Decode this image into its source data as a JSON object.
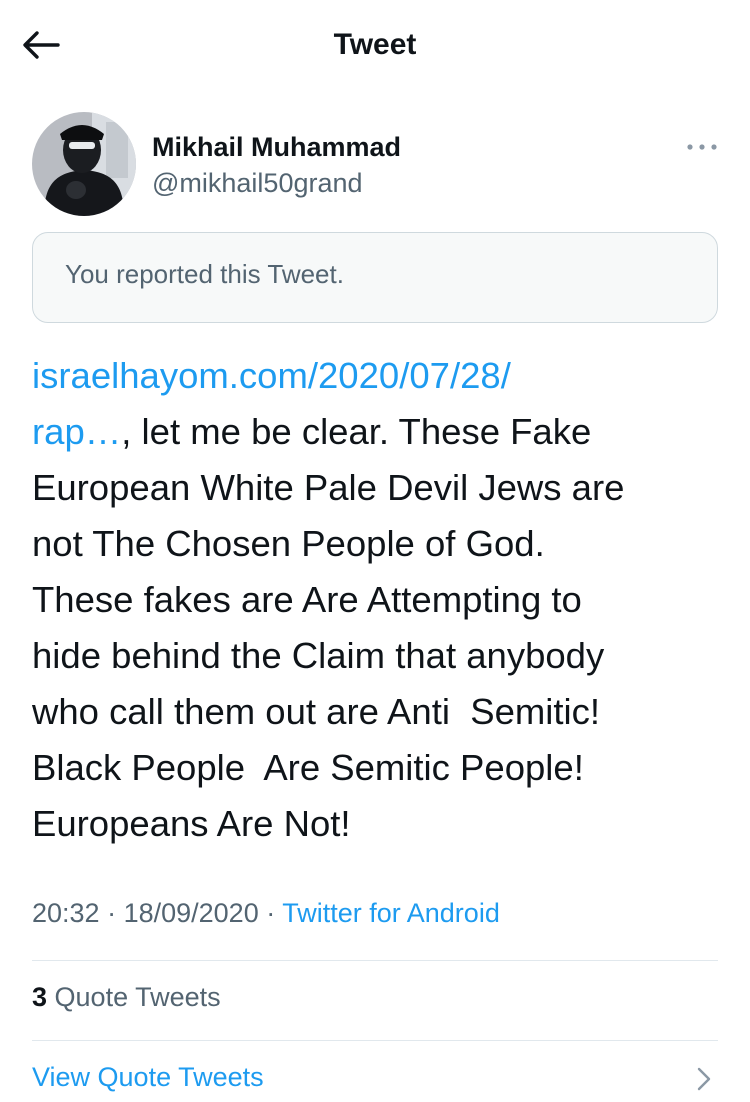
{
  "header": {
    "title": "Tweet",
    "back_icon": "arrow-left-icon"
  },
  "author": {
    "name": "Mikhail Muhammad",
    "handle": "@mikhail50grand",
    "more_icon": "more-horizontal-icon"
  },
  "notice": {
    "text": "You reported this Tweet."
  },
  "tweet": {
    "link_text": "israelhayom.com/2020/07/28/\nrap…",
    "body": ", let me be clear. These Fake\nEuropean White Pale Devil Jews are\nnot The Chosen People of God.\nThese fakes are Are Attempting to\nhide behind the Claim that anybody\nwho call them out are Anti  Semitic!\nBlack People  Are Semitic People!\nEuropeans Are Not!",
    "time": "20:32",
    "separator": " · ",
    "date": "18/09/2020",
    "source": "Twitter for Android"
  },
  "stats": {
    "quote_count": "3",
    "quote_label": " Quote Tweets",
    "view_quotes_label": "View Quote Tweets",
    "view_icon": "chevron-right-icon"
  },
  "colors": {
    "accent": "#1d9bf0",
    "text": "#0f1419",
    "secondary": "#536471",
    "border": "#cfd9de"
  }
}
